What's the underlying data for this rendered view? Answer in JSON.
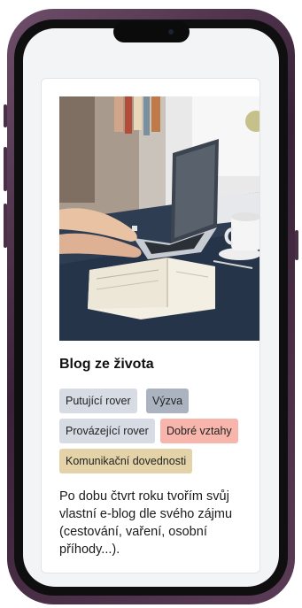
{
  "post": {
    "title": "Blog ze života",
    "description": "Po dobu čtvrt roku tvořím svůj vlastní e-blog dle svého zájmu (cestování, vaření, osobní příhody...).",
    "image": "photo-laptop-notebook-desk"
  },
  "tags": [
    {
      "label": "Putující rover",
      "color": "#d6dbe4"
    },
    {
      "label": "Výzva",
      "color": "#aab3bf"
    },
    {
      "label": "Provázející rover",
      "color": "#d6dbe4"
    },
    {
      "label": "Dobré vztahy",
      "color": "#f7b5ac"
    },
    {
      "label": "Komunikační dovednosti",
      "color": "#e4d3a8"
    }
  ],
  "device": {
    "frame_color": "#4b2e47"
  }
}
